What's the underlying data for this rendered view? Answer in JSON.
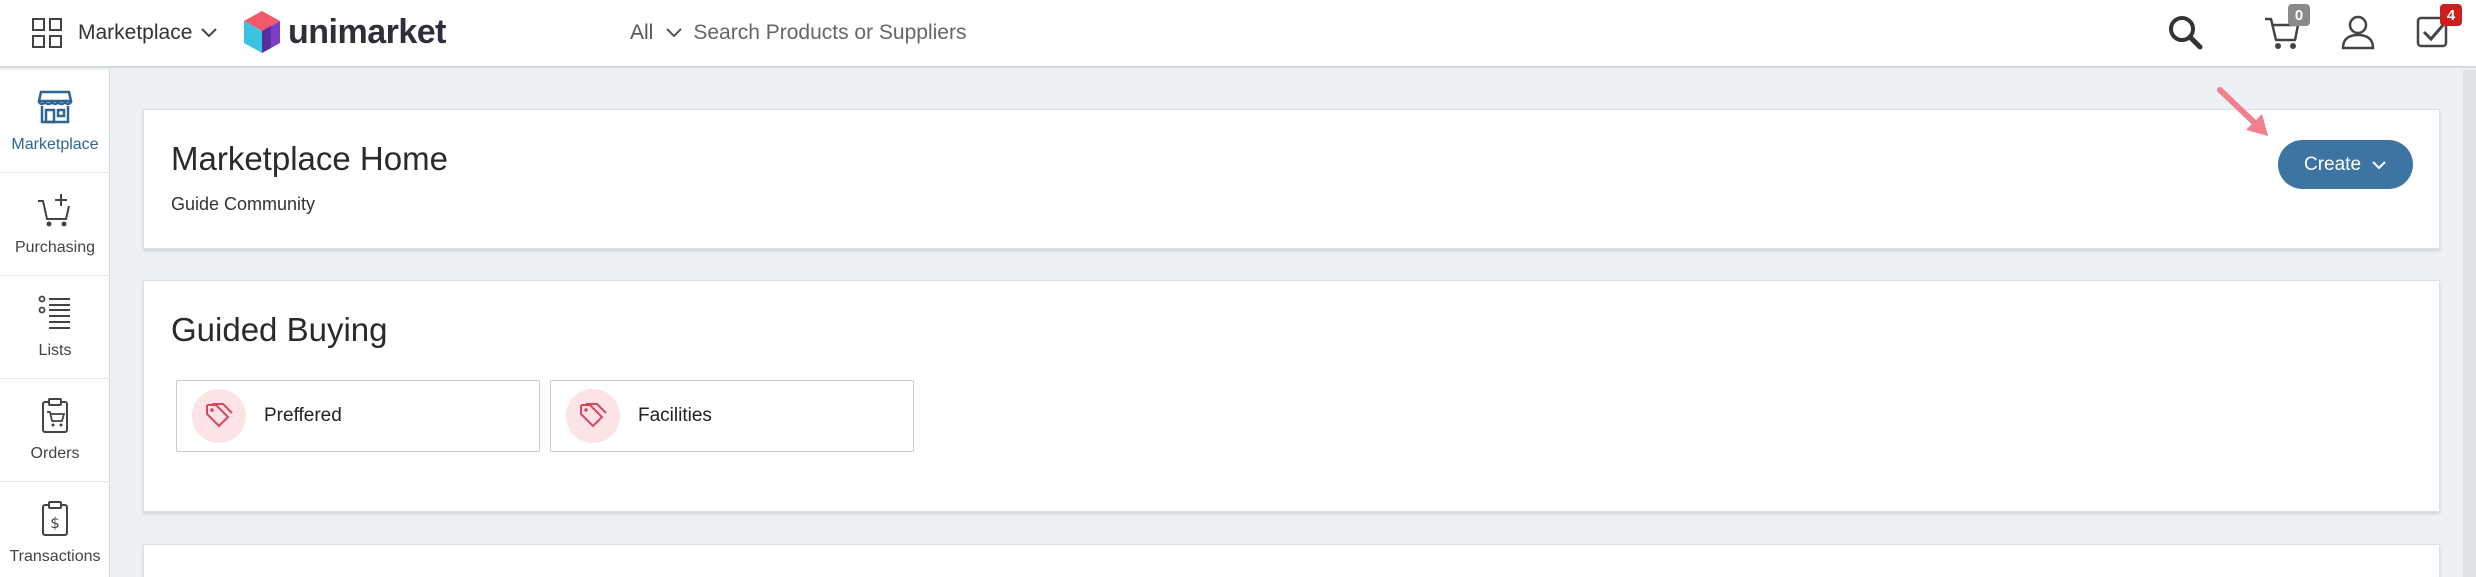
{
  "header": {
    "app_switcher_label": "Marketplace",
    "logo_text": "unimarket",
    "search_scope": "All",
    "search_placeholder": "Search Products or Suppliers",
    "cart_count": "0",
    "tasks_count": "4"
  },
  "sidebar": {
    "items": [
      {
        "label": "Marketplace",
        "icon": "storefront-icon",
        "active": true
      },
      {
        "label": "Purchasing",
        "icon": "cart-add-icon"
      },
      {
        "label": "Lists",
        "icon": "list-icon"
      },
      {
        "label": "Orders",
        "icon": "order-clipboard-icon"
      },
      {
        "label": "Transactions",
        "icon": "dollar-document-icon"
      }
    ]
  },
  "home_card": {
    "title": "Marketplace Home",
    "subtitle": "Guide Community",
    "create_label": "Create"
  },
  "guided_buying": {
    "title": "Guided Buying",
    "tiles": [
      {
        "label": "Preffered",
        "icon": "tag-icon"
      },
      {
        "label": "Facilities",
        "icon": "tag-icon"
      }
    ]
  },
  "colors": {
    "accent": "#3d74a1",
    "active_nav": "#2f6691",
    "tag_bg": "#fbe3e6",
    "tag_icon": "#d9455f",
    "cart_badge": "#8a8a8a",
    "tasks_badge": "#cc1f1f",
    "annotation_arrow": "#f08090"
  }
}
